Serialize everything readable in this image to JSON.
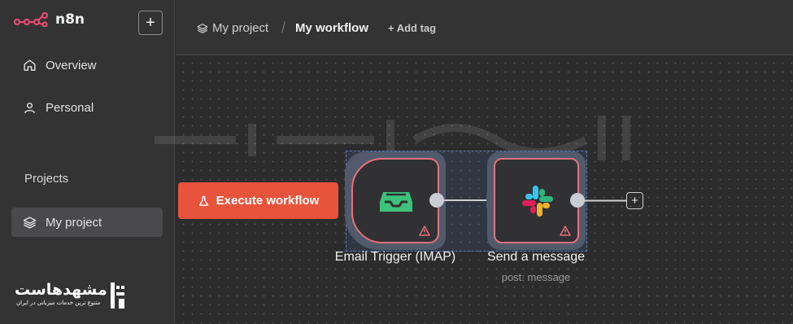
{
  "app": {
    "name": "n8n",
    "brand_color": "#ea4b71"
  },
  "sidebar": {
    "new_button": "+",
    "items": [
      {
        "label": "Overview",
        "icon": "home-icon"
      },
      {
        "label": "Personal",
        "icon": "user-icon"
      }
    ],
    "projects_title": "Projects",
    "projects": [
      {
        "label": "My project",
        "icon": "layers-icon",
        "active": true
      }
    ]
  },
  "watermark": {
    "name": "مشهدهاست",
    "tagline": "متنوع ترین خدمات میزبانی در ایران"
  },
  "header": {
    "project": "My project",
    "separator": "/",
    "workflow": "My workflow",
    "add_tag": "+ Add tag"
  },
  "canvas": {
    "execute_button": "Execute workflow",
    "nodes": [
      {
        "label": "Email Trigger (IMAP)",
        "subtitle": "",
        "icon": "inbox-icon",
        "warning": true
      },
      {
        "label": "Send a message",
        "subtitle": "post: message",
        "icon": "slack-icon",
        "warning": true
      }
    ],
    "add_node": "+"
  },
  "colors": {
    "accent": "#e8533c",
    "node_border": "#e8707c",
    "inbox_green": "#3ec17a"
  }
}
